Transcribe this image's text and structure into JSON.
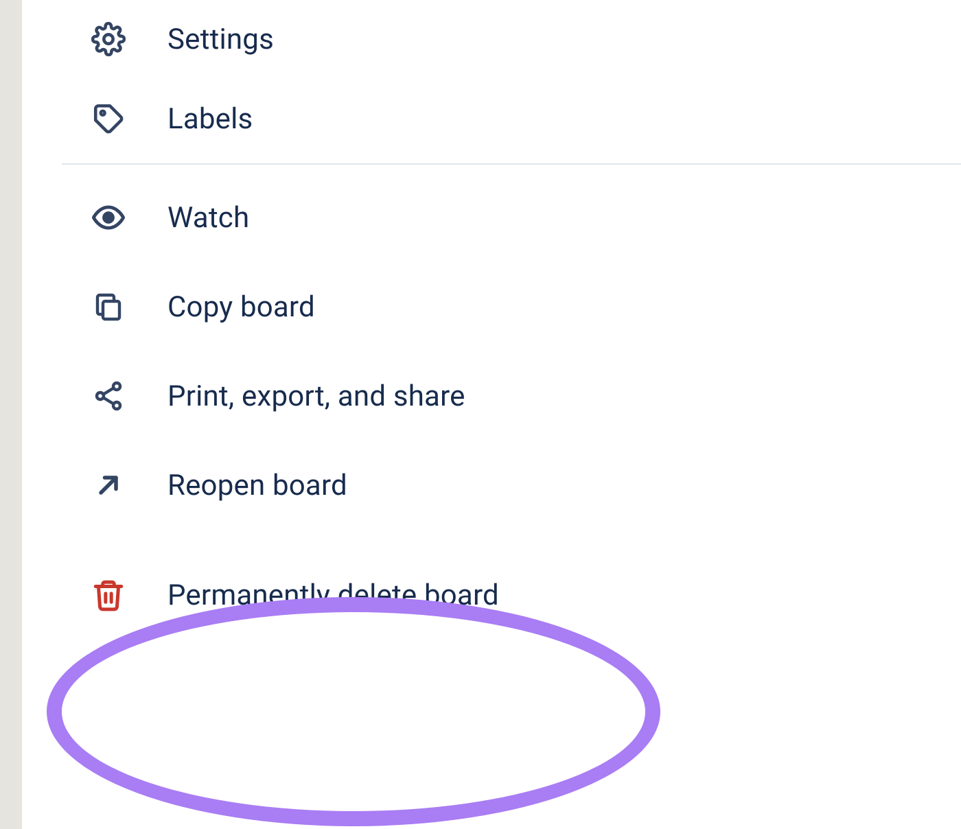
{
  "menu": {
    "section1": [
      {
        "id": "settings",
        "label": "Settings",
        "icon": "gear-icon"
      },
      {
        "id": "labels",
        "label": "Labels",
        "icon": "tag-icon"
      }
    ],
    "section2": [
      {
        "id": "watch",
        "label": "Watch",
        "icon": "eye-icon"
      },
      {
        "id": "copy",
        "label": "Copy board",
        "icon": "copy-icon"
      },
      {
        "id": "share",
        "label": "Print, export, and share",
        "icon": "share-icon"
      },
      {
        "id": "reopen",
        "label": "Reopen board",
        "icon": "arrow-up-right-icon"
      },
      {
        "id": "delete",
        "label": "Permanently delete board",
        "icon": "trash-icon",
        "danger": true
      }
    ]
  },
  "colors": {
    "text": "#172B4D",
    "icon": "#344563",
    "danger": "#C9372C",
    "highlight": "#a97df4"
  }
}
